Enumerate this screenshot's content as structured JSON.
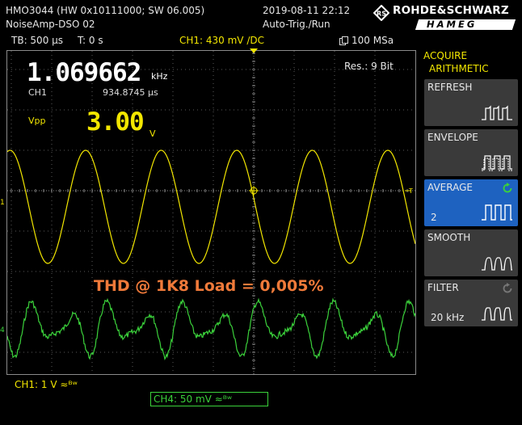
{
  "header": {
    "model": "HMO3044 (HW 0x10111000; SW 06.005)",
    "project": "NoiseAmp-DSO 02",
    "datetime": "2019-08-11 22:12",
    "trigger_mode": "Auto-Trig./Run",
    "brand_top": "ROHDE&SCHWARZ",
    "brand_bottom": "HAMEG"
  },
  "status": {
    "timebase": "TB: 500 µs",
    "trig_time": "T: 0 s",
    "ch1_trigger": "CH1: 430 mV ∕DC",
    "sample_rate": "100 MSa"
  },
  "measurements": {
    "frequency_value": "1.069662",
    "frequency_unit": "kHz",
    "freq_source": "CH1",
    "period": "934.8745 µs",
    "vpp_label": "Vpp",
    "vpp_value": "3.00",
    "vpp_unit": "V",
    "resolution": "Res.: 9 Bit"
  },
  "annotation": "THD @ 1K8 Load = 0,005%",
  "markers": {
    "ch1": "1",
    "ch4": "4"
  },
  "acquire_menu": {
    "title_line1": "ACQUIRE",
    "title_line2": "ARITHMETIC",
    "items": [
      {
        "label": "REFRESH",
        "value": "",
        "icon": "refresh-waveform-icon",
        "active": false
      },
      {
        "label": "ENVELOPE",
        "value": "",
        "icon": "envelope-waveform-icon",
        "active": false
      },
      {
        "label": "AVERAGE",
        "value": "2",
        "icon": "average-waveform-icon",
        "active": true
      },
      {
        "label": "SMOOTH",
        "value": "",
        "icon": "smooth-waveform-icon",
        "active": false
      },
      {
        "label": "FILTER",
        "value": "20 kHz",
        "icon": "filter-waveform-icon",
        "active": false
      }
    ]
  },
  "channels": {
    "ch1_scale": "CH1: 1 V ≈ᴮʷ",
    "ch4_scale": "CH4: 50 mV ≈ᴮʷ"
  },
  "colors": {
    "ch1": "#f2e600",
    "ch4": "#3bd23b",
    "annotation": "#f07a3a",
    "active_softkey": "#1e62c0",
    "grid": "#6b6b6b"
  }
}
